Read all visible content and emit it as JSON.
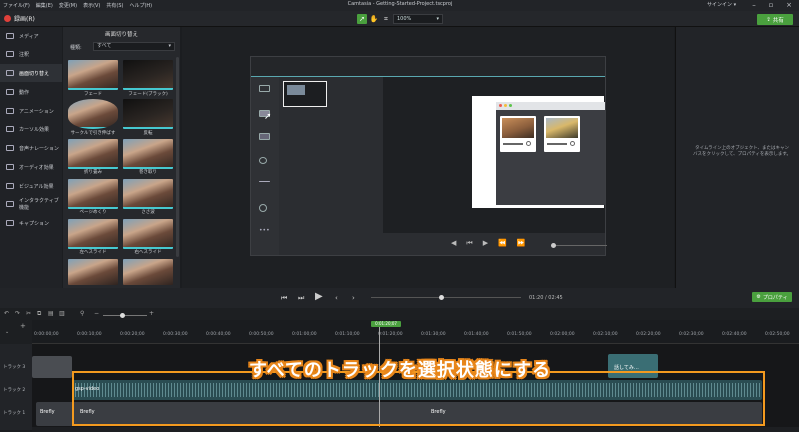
{
  "menu": [
    "ファイル(F)",
    "編集(E)",
    "変更(M)",
    "表示(V)",
    "共有(S)",
    "ヘルプ(H)"
  ],
  "window_title": "Camtasia - Getting-Started-Project.tscproj",
  "sign_in": "サインイン ▾",
  "record_label": "録画(R)",
  "zoom": "100%",
  "share_label": "共有",
  "nav": [
    "メディア",
    "注釈",
    "画面切り替え",
    "動作",
    "アニメーション",
    "カーソル効果",
    "音声ナレーション",
    "オーディオ効果",
    "ビジュアル効果",
    "インタラクティブ機能",
    "キャプション"
  ],
  "panel": {
    "title": "画面切り替え",
    "type_label": "種類:",
    "type_value": "すべて",
    "thumbs": [
      "フェード",
      "フェード(ブラック)",
      "サークルで引き伸ばす",
      "反転",
      "折り畳み",
      "巻き取り",
      "ページめくり",
      "ささ波",
      "左へスライド",
      "右へスライド",
      "",
      ""
    ]
  },
  "properties_message": "タイムライン上のオブジェクト、またはキャンバスをクリックして、プロパティを表示します。",
  "playback": {
    "time": "01:20 / 02:45",
    "properties_label": "プロパティ"
  },
  "ruler": [
    "0:00:00;00",
    "0:00:10;00",
    "0:00:20;00",
    "0:00:30;00",
    "0:00:40;00",
    "0:00:50;00",
    "0:01:00;00",
    "0:01:10;00",
    "0:01:20;00",
    "0:01:30;00",
    "0:01:40;00",
    "0:01:50;00",
    "0:02:00;00",
    "0:02:10;00",
    "0:02:20;00",
    "0:02:30;00",
    "0:02:40;00",
    "0:02:50;00"
  ],
  "playhead_time": "0:01:20;07",
  "tracks": [
    "トラック 3",
    "トラック 2",
    "トラック 1"
  ],
  "clips": {
    "audio": "gsp-video",
    "v1a": "Brefly",
    "v1b": "Brefly",
    "v1c": "Brefly",
    "t3": "話してみ…"
  },
  "caption": "すべてのトラックを選択状態にする"
}
